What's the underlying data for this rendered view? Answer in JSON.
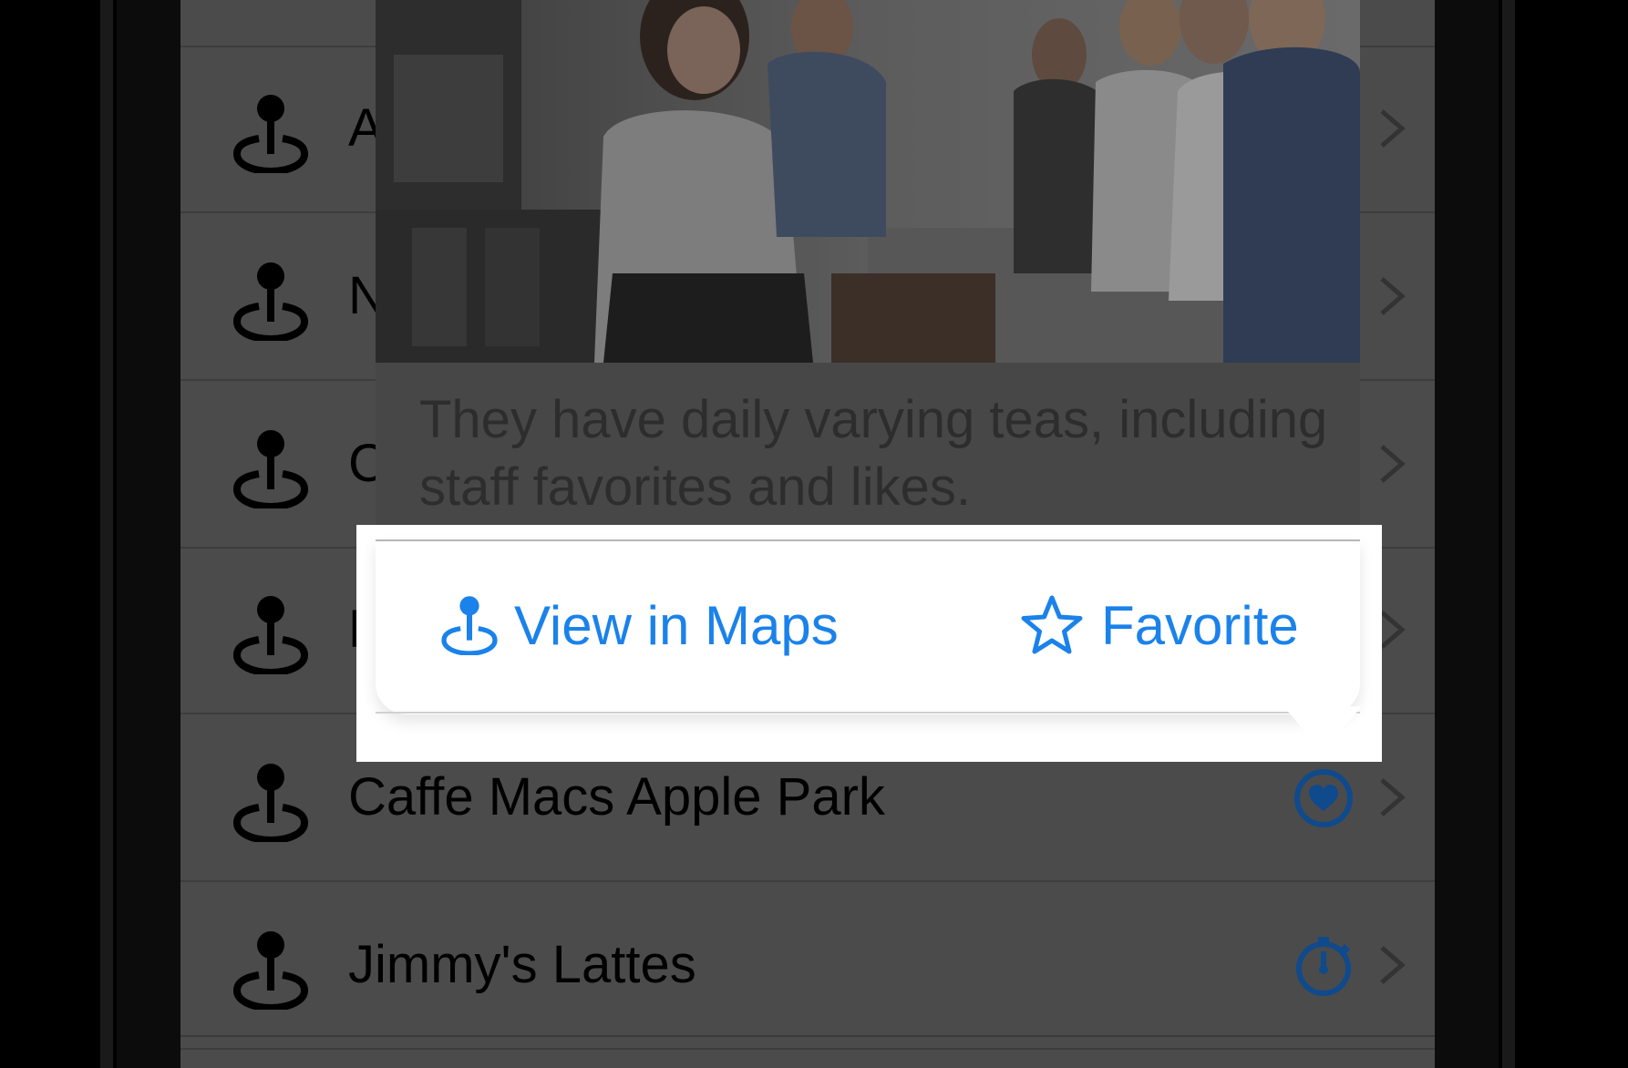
{
  "colors": {
    "accent": "#1a82ea",
    "dimmed_accent": "#0f4a8c",
    "dim_background": "#4b4b4b"
  },
  "list": {
    "rows": [
      {
        "label": "A",
        "icon": "map-pin-icon"
      },
      {
        "label": "N",
        "icon": "map-pin-icon"
      },
      {
        "label": "C",
        "icon": "map-pin-icon"
      },
      {
        "label": "F",
        "icon": "map-pin-icon"
      },
      {
        "label": "Caffe Macs Apple Park",
        "icon": "map-pin-icon",
        "status_icon": "heart-circle-icon"
      },
      {
        "label": "Jimmy's Lattes",
        "icon": "map-pin-icon",
        "status_icon": "timer-icon"
      }
    ]
  },
  "preview": {
    "image": "coffee-shop-counter-photo",
    "description": "They have daily varying teas, including staff favorites and likes."
  },
  "menu": {
    "view_in_maps": {
      "label": "View in Maps",
      "icon": "map-pin-icon"
    },
    "favorite": {
      "label": "Favorite",
      "icon": "star-icon"
    }
  }
}
